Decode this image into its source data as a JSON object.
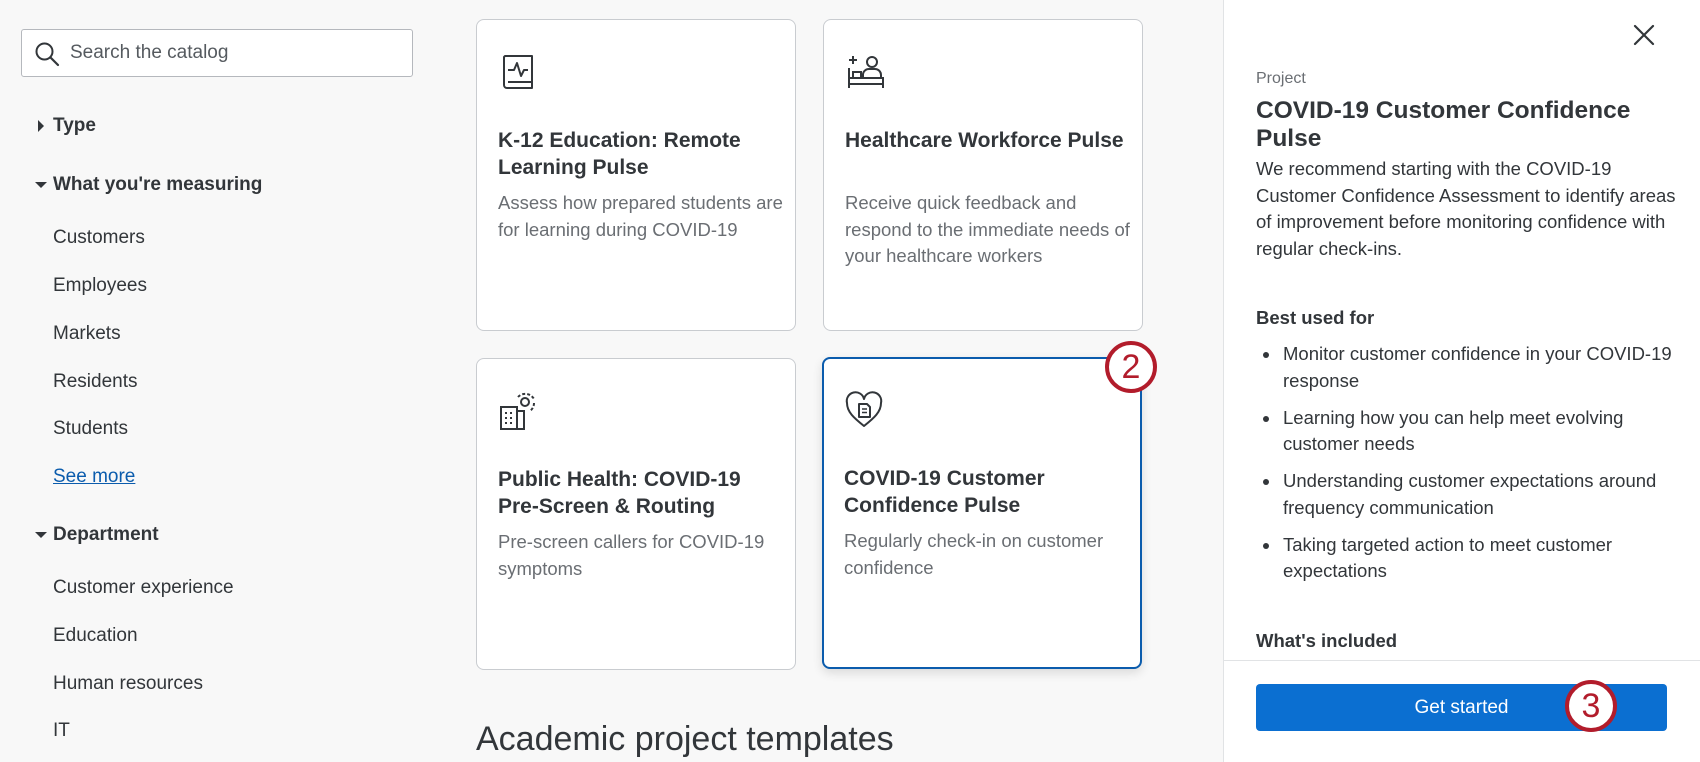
{
  "search": {
    "placeholder": "Search the catalog"
  },
  "filters": {
    "type_label": "Type",
    "measuring_label": "What you're measuring",
    "measuring_items": [
      "Customers",
      "Employees",
      "Markets",
      "Residents",
      "Students"
    ],
    "see_more": "See more",
    "department_label": "Department",
    "department_items": [
      "Customer experience",
      "Education",
      "Human resources",
      "IT"
    ]
  },
  "cards": [
    {
      "icon": "monitor-book-icon",
      "title": "K-12 Education: Remote Learning Pulse",
      "description": "Assess how prepared students are for learning during COVID-19",
      "selected": false
    },
    {
      "icon": "hospital-bed-icon",
      "title": "Healthcare Workforce Pulse",
      "description": "Receive quick feedback and respond to the immediate needs of your healthcare workers",
      "selected": false
    },
    {
      "icon": "building-signal-icon",
      "title": "Public Health: COVID-19 Pre-Screen & Routing",
      "description": "Pre-screen callers for COVID-19 symptoms",
      "selected": false
    },
    {
      "icon": "heart-document-icon",
      "title": "COVID-19 Customer Confidence Pulse",
      "description": "Regularly check-in on customer confidence",
      "selected": true
    }
  ],
  "section_heading": "Academic project templates",
  "step_badges": {
    "card": "2",
    "button": "3"
  },
  "panel": {
    "kicker": "Project",
    "title": "COVID-19 Customer Confidence Pulse",
    "description": "We recommend starting with the COVID-19 Customer Confidence Assessment to identify areas of improvement before monitoring confidence with regular check-ins.",
    "best_used_label": "Best used for",
    "best_used_items": [
      "Monitor customer confidence in your COVID-19 response",
      "Learning how you can help meet evolving customer needs",
      "Understanding customer expectations around frequency communication",
      "Taking targeted action to meet customer expectations"
    ],
    "included_label": "What's included",
    "cta_label": "Get started"
  },
  "colors": {
    "accent": "#0b6fd1",
    "selected_border": "#0b5cad",
    "badge": "#b21c2b"
  }
}
